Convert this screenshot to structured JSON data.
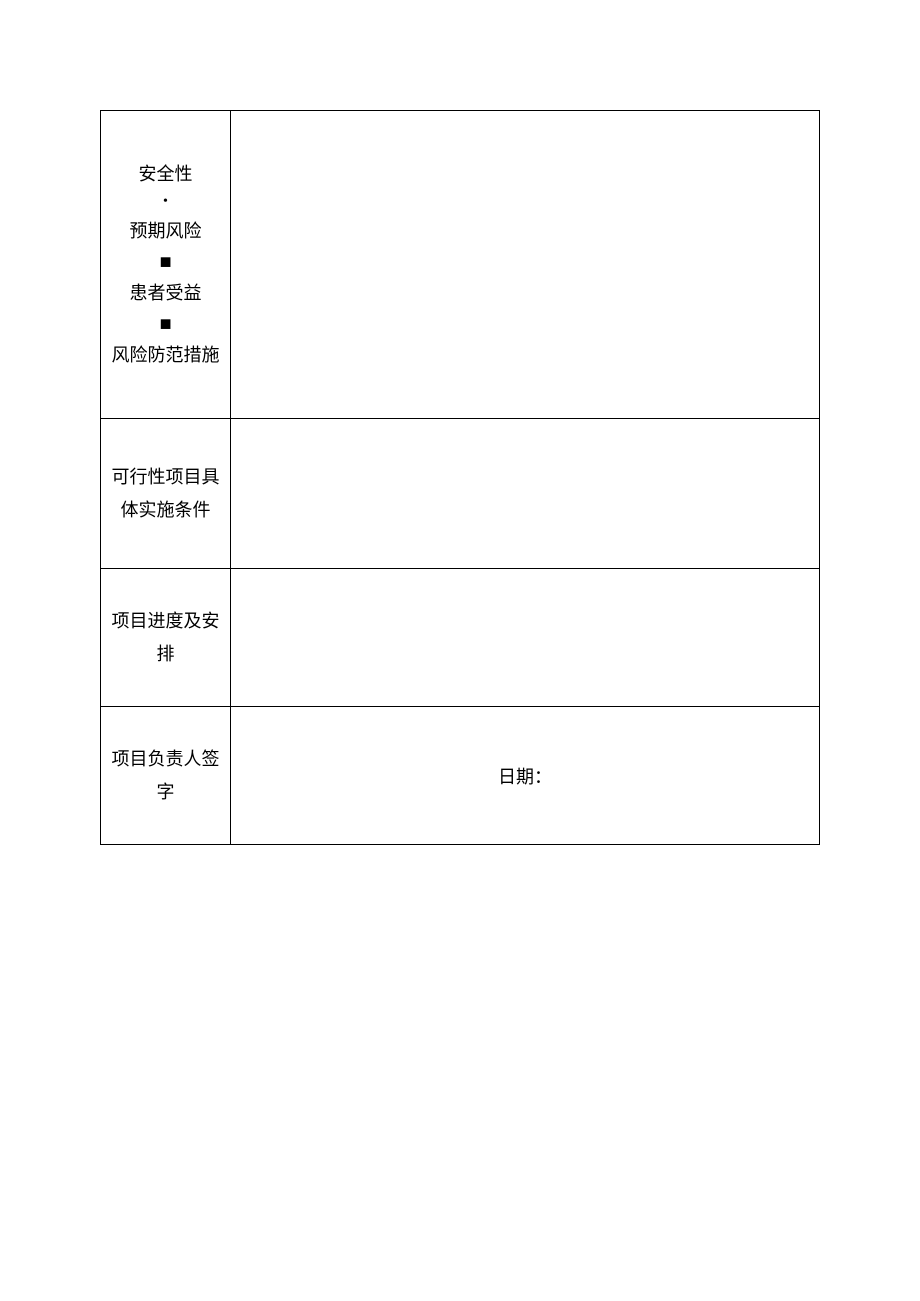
{
  "labels": {
    "row1": {
      "line1": "安全性",
      "bullet1": "•",
      "line2": "预期风险",
      "bullet2": "■",
      "line3": "患者受益",
      "bullet3": "■",
      "line4": "风险防范措施"
    },
    "row2": "可行性项目具体实施条件",
    "row3": "项目进度及安排",
    "row4": "项目负责人签字"
  },
  "content": {
    "row1": "",
    "row2": "",
    "row3": "",
    "row4_date_label": "日期："
  }
}
